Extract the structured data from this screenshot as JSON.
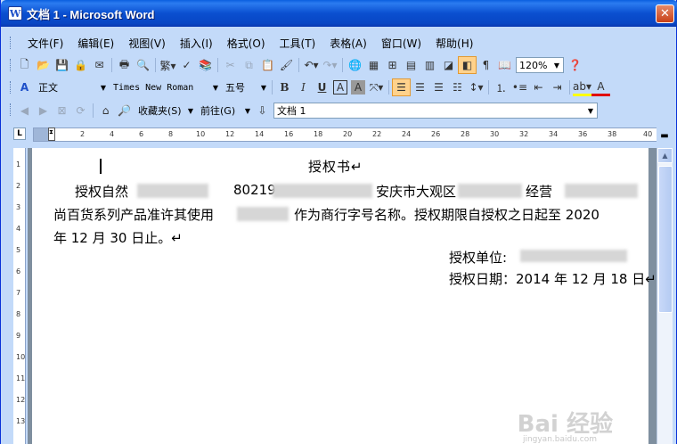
{
  "window": {
    "title": "文档 1 - Microsoft Word",
    "title_icon": "W",
    "close_glyph": "✕"
  },
  "menu": [
    "文件(F)",
    "编辑(E)",
    "视图(V)",
    "插入(I)",
    "格式(O)",
    "工具(T)",
    "表格(A)",
    "窗口(W)",
    "帮助(H)"
  ],
  "standard_toolbar": {
    "zoom": "120%"
  },
  "format_toolbar": {
    "style": "正文",
    "font": "Times New Roman",
    "size": "五号",
    "bold": "B",
    "italic": "I",
    "underline": "U",
    "font_color_label": "A"
  },
  "web_toolbar": {
    "favorites": "收藏夹(S)",
    "goto": "前往(G)",
    "address": "文档 1"
  },
  "ruler": {
    "marks": [
      "2",
      "4",
      "6",
      "8",
      "10",
      "12",
      "14",
      "16",
      "18",
      "20",
      "22",
      "24",
      "26",
      "28",
      "30",
      "32",
      "34",
      "36",
      "38",
      "40"
    ],
    "left_mark": "8",
    "corner": "L"
  },
  "vruler_marks": [
    "1",
    "2",
    "3",
    "4",
    "5",
    "6",
    "7",
    "8",
    "9",
    "10",
    "11",
    "12",
    "13"
  ],
  "document": {
    "title": "授权书↵",
    "line1": "授权自然",
    "line1b": "80219",
    "line1c": "安庆市大观区",
    "line1d": "经营",
    "line2": "尚百货系列产品准许其使用",
    "line2b": "作为商行字号名称。授权期限自授权之日起至 2020",
    "line3": "年 12 月 30 日止。↵",
    "unit": "授权单位:",
    "date": "授权日期：2014 年 12 月 18 日↵"
  },
  "watermark": {
    "text": "Bai 经验",
    "url": "jingyan.baidu.com"
  }
}
